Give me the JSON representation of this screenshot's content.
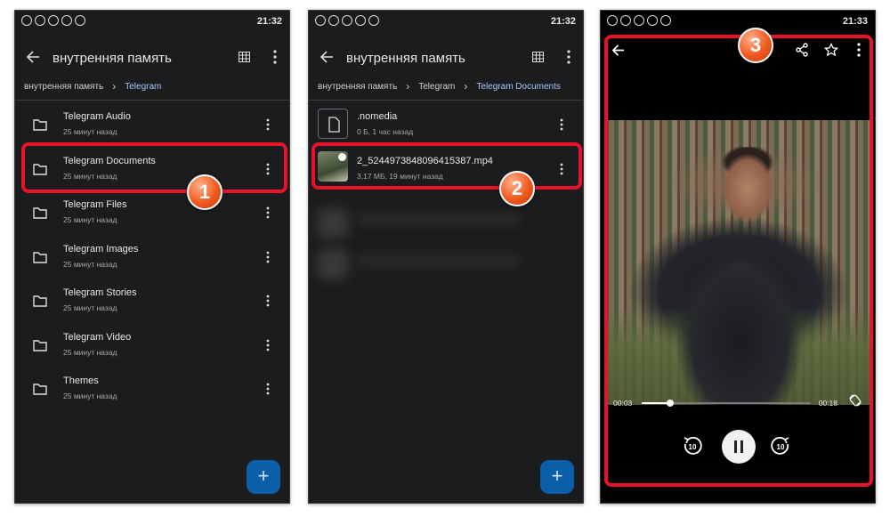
{
  "status_bar": {
    "icons": [
      "whatsapp-icon",
      "whatsapp-icon",
      "viber-icon",
      "people-icon",
      "play-store-icon"
    ],
    "times": [
      "21:32",
      "21:32",
      "21:33"
    ]
  },
  "panel1": {
    "title": "внутренняя память",
    "breadcrumbs": [
      "внутренняя память",
      "Telegram"
    ],
    "items": [
      {
        "name": "Telegram Audio",
        "meta": "25 минут назад"
      },
      {
        "name": "Telegram Documents",
        "meta": "25 минут назад"
      },
      {
        "name": "Telegram Files",
        "meta": "25 минут назад"
      },
      {
        "name": "Telegram Images",
        "meta": "25 минут назад"
      },
      {
        "name": "Telegram Stories",
        "meta": "25 минут назад"
      },
      {
        "name": "Telegram Video",
        "meta": "25 минут назад"
      },
      {
        "name": "Themes",
        "meta": "25 минут назад"
      }
    ],
    "fab": "+",
    "step": "1"
  },
  "panel2": {
    "title": "внутренняя память",
    "breadcrumbs": [
      "внутренняя память",
      "Telegram",
      "Telegram Documents"
    ],
    "items": [
      {
        "name": ".nomedia",
        "meta": "0 Б, 1 час назад"
      },
      {
        "name": "2_5244973848096415387.mp4",
        "meta": "3,17 МБ, 19 минут назад"
      }
    ],
    "fab": "+",
    "step": "2"
  },
  "panel3": {
    "player": {
      "current_time": "00:03",
      "duration": "00:18",
      "progress": 0.17,
      "skip_back": "10",
      "skip_forward": "10"
    },
    "step": "3"
  },
  "colors": {
    "highlight": "#e8132a",
    "badge": "#f05a1f",
    "accent": "#a8c7fa",
    "fab": "#0b5ea8"
  }
}
